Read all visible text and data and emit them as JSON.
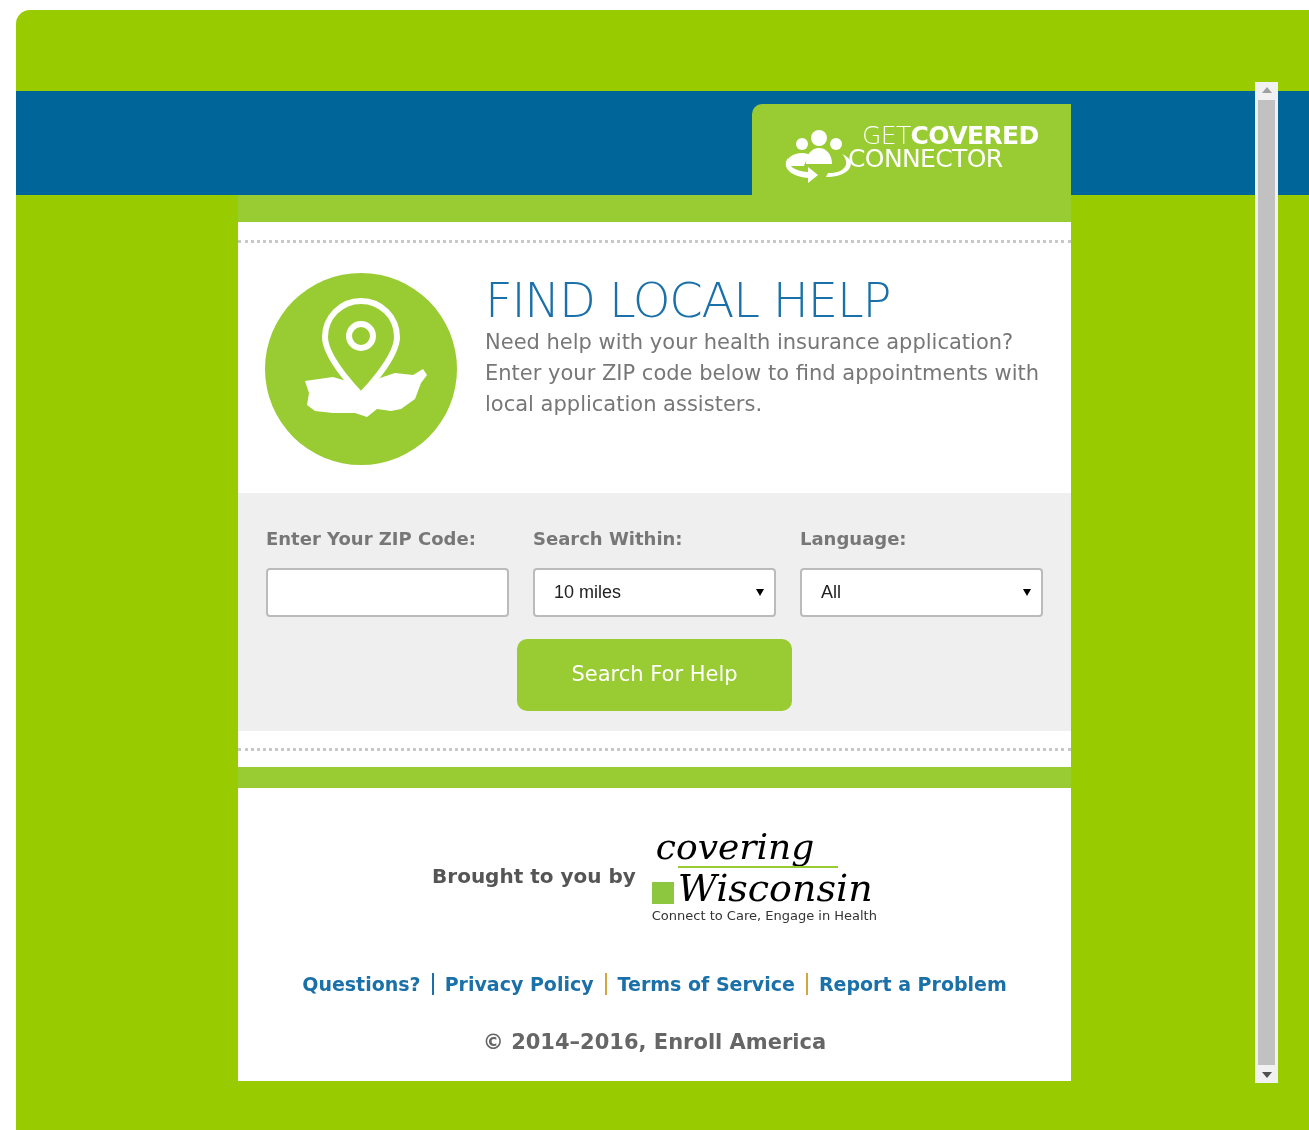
{
  "header_logo": {
    "light": "GET",
    "bold": "COVERED",
    "second_line": "CONNECTOR"
  },
  "intro": {
    "title": "FIND LOCAL HELP",
    "text": "Need help with your health insurance application? Enter your ZIP code below to find appointments with local application assisters."
  },
  "form": {
    "fields": [
      {
        "kind": "text",
        "label": "Enter Your ZIP Code:"
      },
      {
        "kind": "select",
        "label": "Search Within:",
        "value": "10 miles"
      },
      {
        "kind": "select",
        "label": "Language:",
        "value": "All"
      }
    ],
    "button": "Search For Help"
  },
  "sponsor": {
    "label": "Brought to you by",
    "logo_top": "covering",
    "logo_main": "Wisconsin",
    "tagline": "Connect to Care, Engage in Health"
  },
  "footer_links": [
    "Questions?",
    "Privacy Policy",
    "Terms of Service",
    "Report a Problem"
  ],
  "copyright": "© 2014–2016, Enroll America"
}
